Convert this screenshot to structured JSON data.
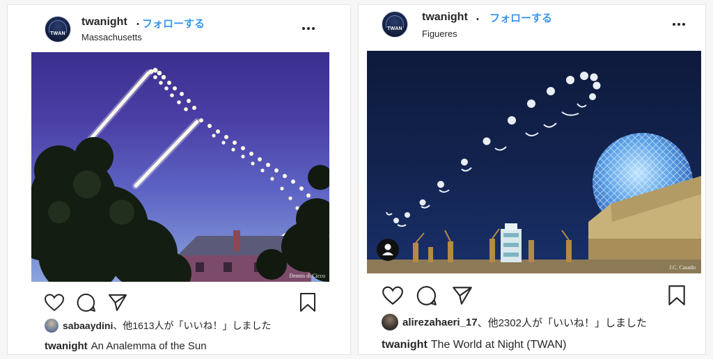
{
  "posts": [
    {
      "username": "twanight",
      "separator": "・",
      "follow_label": "フォローする",
      "location": "Massachusetts",
      "avatar_text": "TWAN",
      "photo_credit": "Dennis di Cicco",
      "likes": {
        "user": "sabaaydini",
        "text": "、他1613人が「いいね！」しました"
      },
      "caption": {
        "user": "twanight",
        "text": "An Analemma of the Sun"
      }
    },
    {
      "username": "twanight",
      "separator": "・",
      "follow_label": "フォローする",
      "location": "Figueres",
      "avatar_text": "TWAN",
      "photo_credit": "J.C. Casado",
      "likes": {
        "user": "alirezahaeri_17",
        "text": "、他2302人が「いいね！」しました"
      },
      "caption": {
        "user": "twanight",
        "text": "The World at Night (TWAN)"
      }
    }
  ],
  "icons": [
    "more-icon",
    "heart-icon",
    "comment-icon",
    "share-icon",
    "bookmark-icon",
    "user-tag-icon"
  ],
  "colors": {
    "follow": "#3897f0",
    "text": "#262626",
    "border": "#e4e4e4"
  }
}
